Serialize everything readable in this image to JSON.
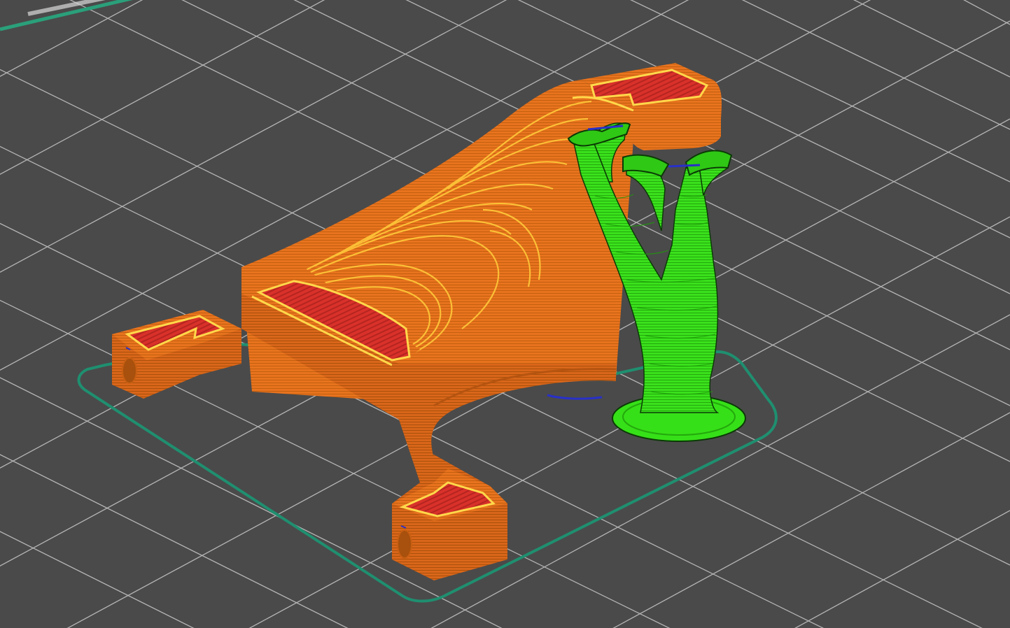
{
  "viewport": {
    "kind": "3d-slicer-gcode-preview",
    "background_color": "#4a4a4a",
    "grid_line_color": "#c8c8c8",
    "colors": {
      "outer_wall": "#e8731e",
      "outer_wall_dark": "#c95f12",
      "inner_wall": "#ffd84a",
      "top_surface": "#d9312a",
      "support": "#36e018",
      "support_dark": "#22b60a",
      "support_edge": "#0b3a06",
      "skirt": "#1f8f70",
      "seam": "#2830c8"
    },
    "objects": [
      "printed-part",
      "tree-support",
      "skirt-outline"
    ]
  }
}
